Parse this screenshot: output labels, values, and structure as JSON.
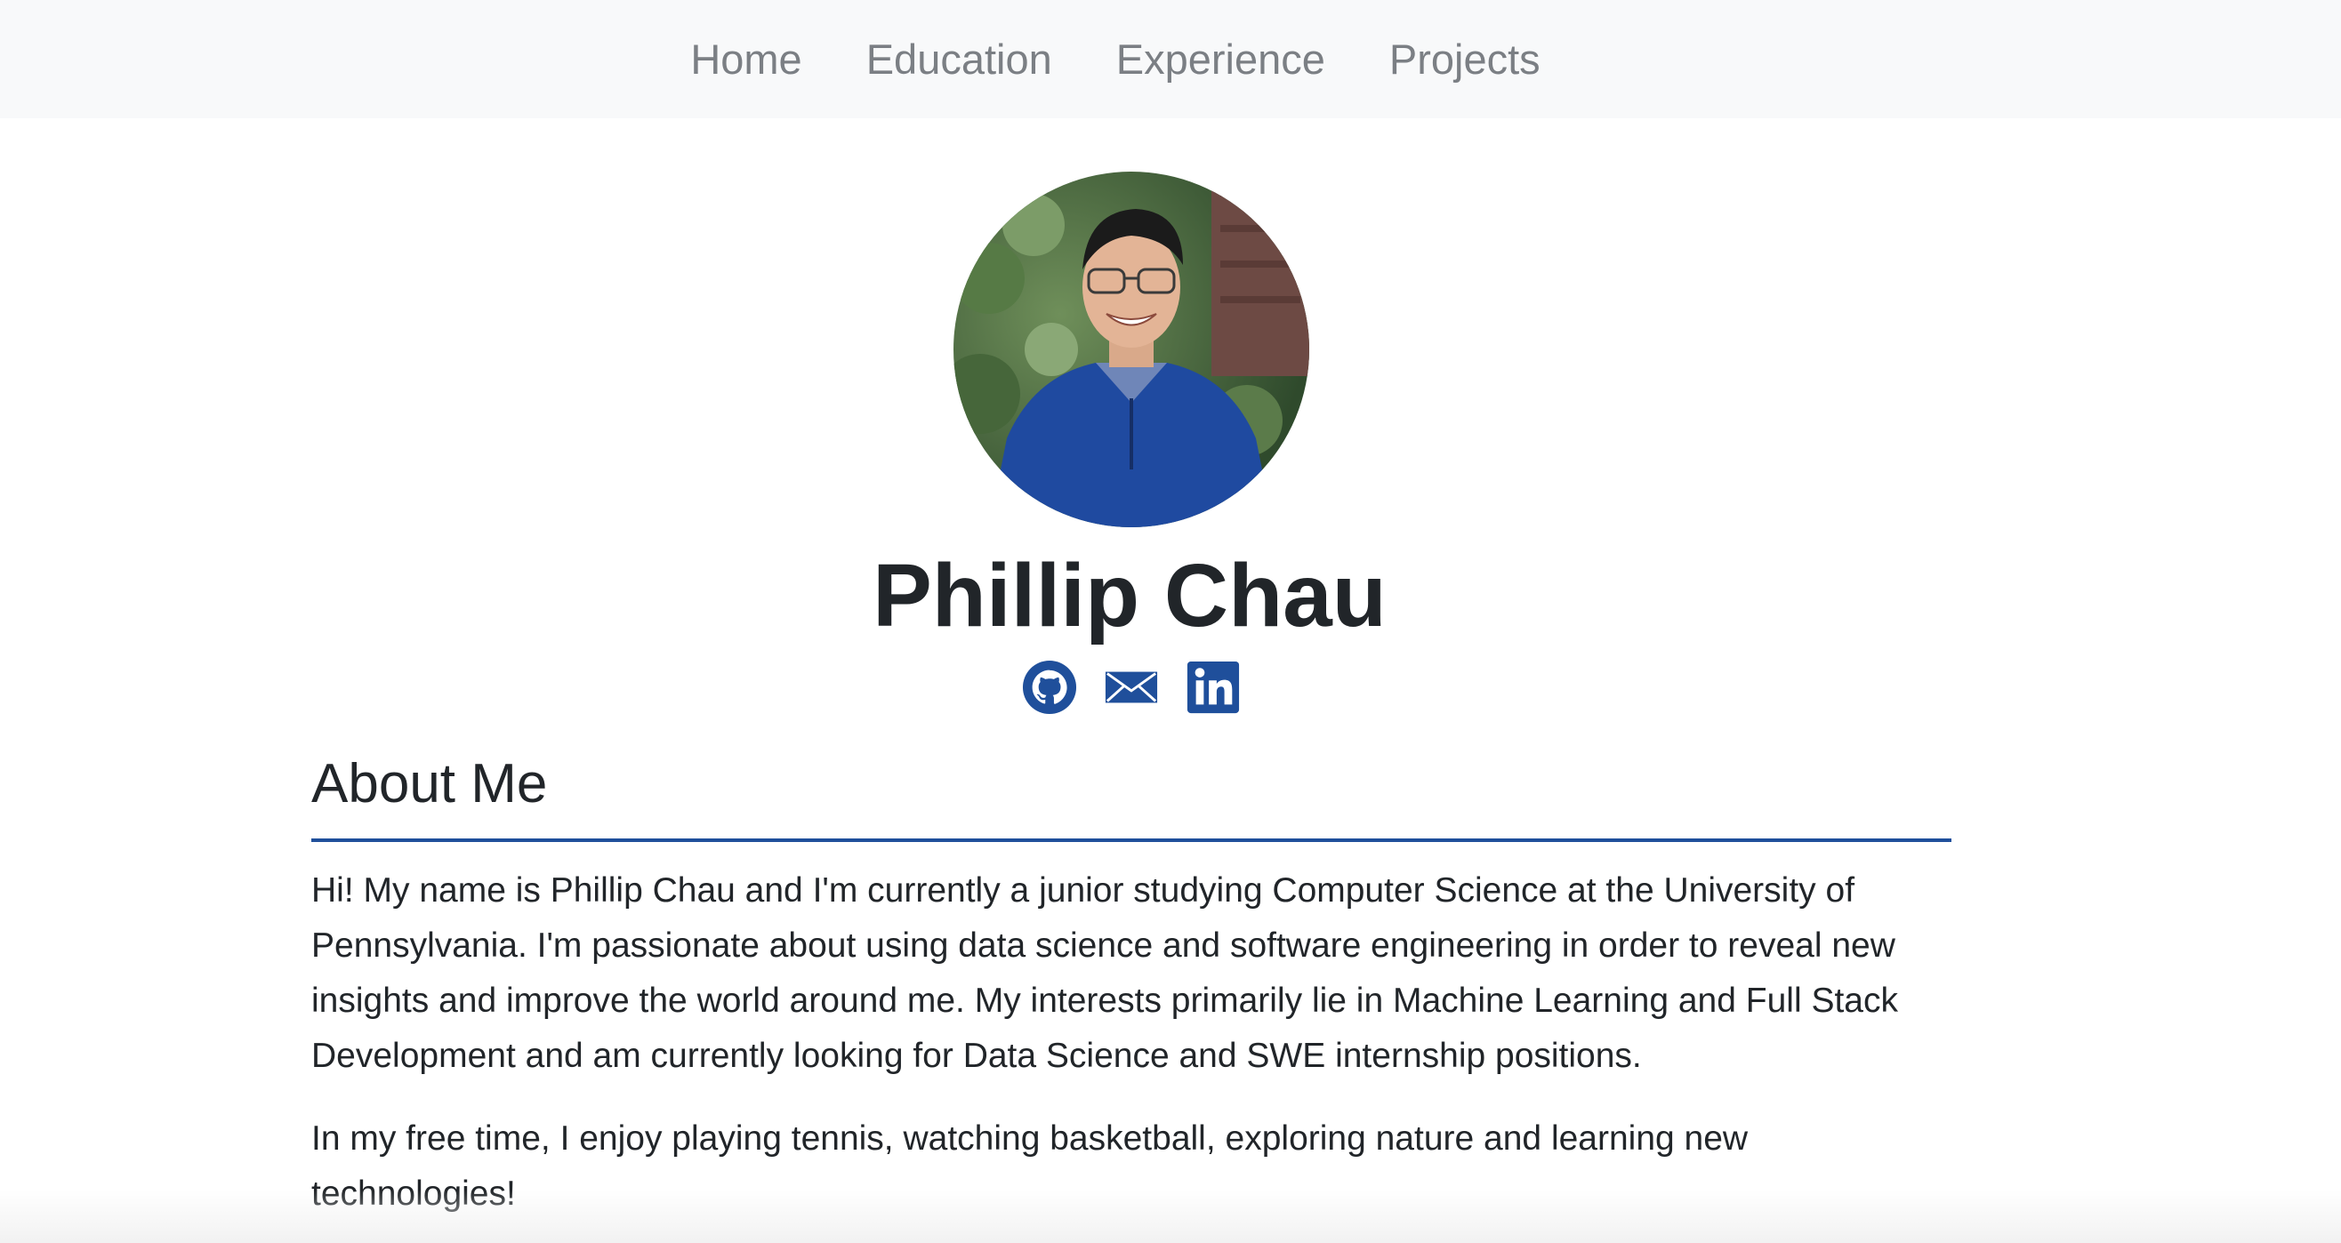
{
  "nav": {
    "items": [
      {
        "label": "Home"
      },
      {
        "label": "Education"
      },
      {
        "label": "Experience"
      },
      {
        "label": "Projects"
      }
    ]
  },
  "profile": {
    "name": "Phillip Chau",
    "avatar_alt": "Phillip Chau",
    "social": [
      {
        "icon": "github-icon"
      },
      {
        "icon": "email-icon"
      },
      {
        "icon": "linkedin-icon"
      }
    ]
  },
  "about": {
    "title": "About Me",
    "paragraphs": [
      "Hi! My name is Phillip Chau and I'm currently a junior studying Computer Science at the University of Pennsylvania. I'm passionate about using data science and software engineering in order to reveal new insights and improve the world around me. My interests primarily lie in Machine Learning and Full Stack Development and am currently looking for Data Science and SWE internship positions.",
      "In my free time, I enjoy playing tennis, watching basketball, exploring nature and learning new technologies!"
    ]
  },
  "colors": {
    "nav_bg": "#f8f9fa",
    "nav_text": "#7b7f84",
    "accent": "#1f4f9b",
    "text": "#212529"
  }
}
